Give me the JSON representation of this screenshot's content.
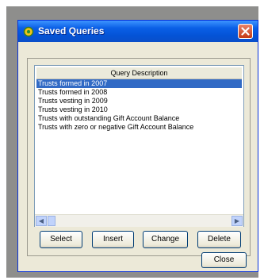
{
  "window": {
    "title": "Saved Queries"
  },
  "list": {
    "header": "Query Description",
    "items": [
      {
        "label": "Trusts formed in 2007",
        "selected": true
      },
      {
        "label": "Trusts formed in 2008",
        "selected": false
      },
      {
        "label": "Trusts vesting in 2009",
        "selected": false
      },
      {
        "label": "Trusts vesting in 2010",
        "selected": false
      },
      {
        "label": "Trusts with outstanding Gift Account Balance",
        "selected": false
      },
      {
        "label": "Trusts with zero or negative Gift Account Balance",
        "selected": false
      }
    ]
  },
  "buttons": {
    "select": "Select",
    "insert": "Insert",
    "change": "Change",
    "delete": "Delete",
    "close": "Close"
  },
  "scrollbar": {
    "left_arrow": "◀",
    "right_arrow": "▶"
  },
  "colors": {
    "titlebar": "#0a5fe6",
    "selection": "#316ac5",
    "dialog_bg": "#ece9d8",
    "close_button": "#c43a14"
  },
  "icons": {
    "app": "saved-queries-app-icon",
    "close": "close-icon"
  }
}
